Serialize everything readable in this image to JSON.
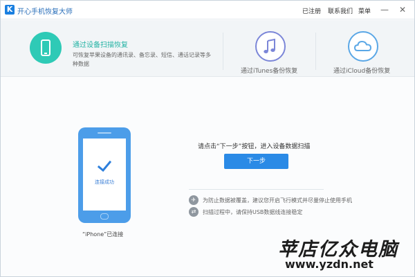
{
  "titlebar": {
    "logo": "K",
    "title": "开心手机恢复大师",
    "registered": "已注册",
    "contact": "联系我们",
    "menu": "菜单",
    "minimize": "—",
    "close": "✕"
  },
  "modes": {
    "scan": {
      "title": "通过设备扫描恢复",
      "description": "可恢复苹果设备的通讯录、备忘录、短信、通话记录等多种数据",
      "icon": "phone-icon"
    },
    "itunes": {
      "label": "通过iTunes备份恢复",
      "icon": "music-note-icon"
    },
    "icloud": {
      "label": "通过iCloud备份恢复",
      "icon": "cloud-icon"
    }
  },
  "main": {
    "prompt": "请点击“下一步”按钮，进入设备数据扫描",
    "next_label": "下一步",
    "phone_status": "连接成功",
    "connected_label": "“iPhone”已连接",
    "tips": [
      {
        "icon": "airplane-icon",
        "text": "为防止数据被覆盖，建议您开启飞行模式并尽量停止使用手机"
      },
      {
        "icon": "usb-icon",
        "text": "扫描过程中，请保持USB数据线连接稳定"
      }
    ]
  },
  "brand": {
    "name": "苹店亿众电脑",
    "url": "www.yzdn.net"
  },
  "colors": {
    "accent_blue": "#2a8ae6",
    "scan_teal": "#2ecab6",
    "itunes_purple": "#7b86d8",
    "icloud_blue": "#5aa7e6"
  }
}
